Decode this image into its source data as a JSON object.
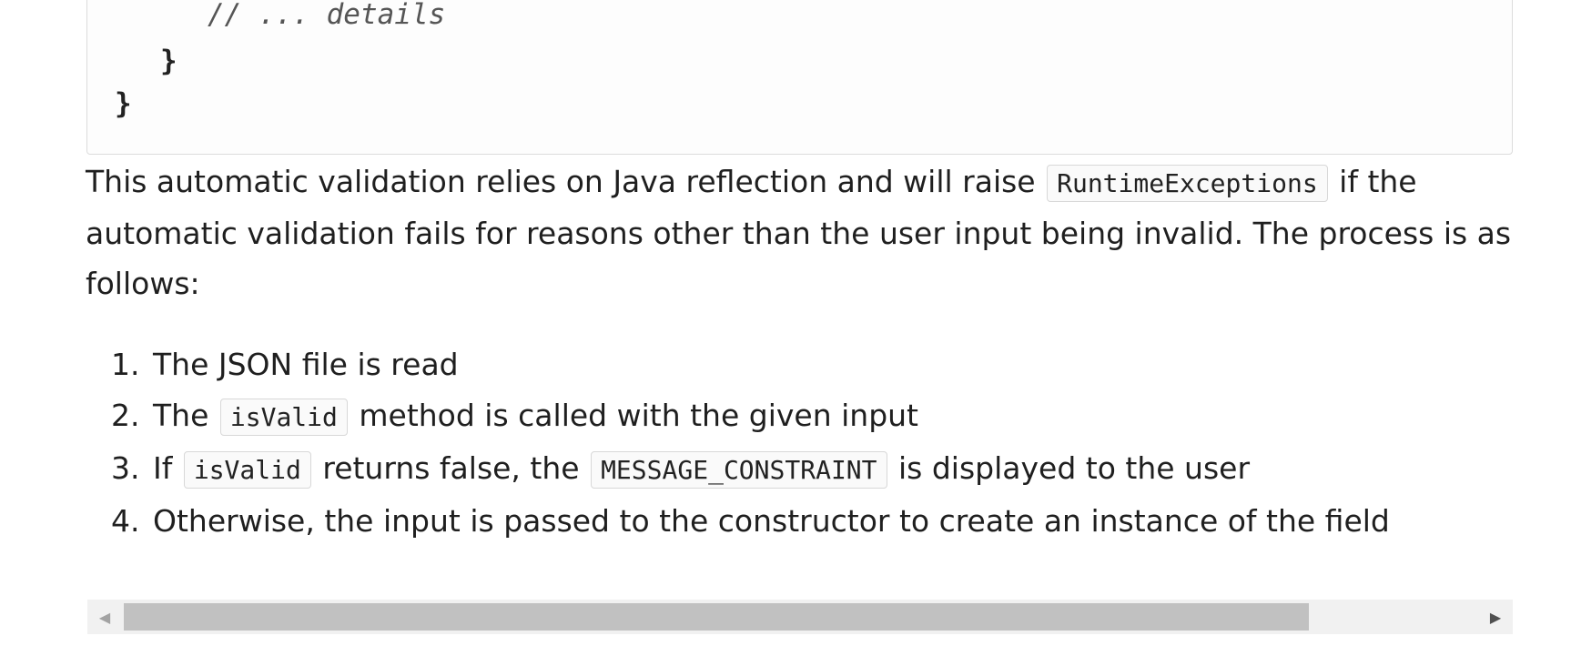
{
  "code_block": {
    "comment_line": "// ... details",
    "inner_brace": "}",
    "outer_brace": "}"
  },
  "paragraph": {
    "part1": "This automatic validation relies on Java reflection and will raise ",
    "code1": "RuntimeExceptions",
    "part2": " if the automatic validation fails for reasons other than the user input being invalid. The process is as follows:"
  },
  "steps": [
    {
      "text": "The JSON file is read"
    },
    {
      "pre": "The ",
      "code": "isValid",
      "post": " method is called with the given input"
    },
    {
      "pre": "If ",
      "code": "isValid",
      "mid": " returns false, the ",
      "code2": "MESSAGE_CONSTRAINT",
      "post": " is displayed to the user"
    },
    {
      "text": "Otherwise, the input is passed to the constructor to create an instance of the field"
    }
  ],
  "scrollbar": {
    "left_arrow": "◀",
    "right_arrow": "▶",
    "position": 0.0
  }
}
